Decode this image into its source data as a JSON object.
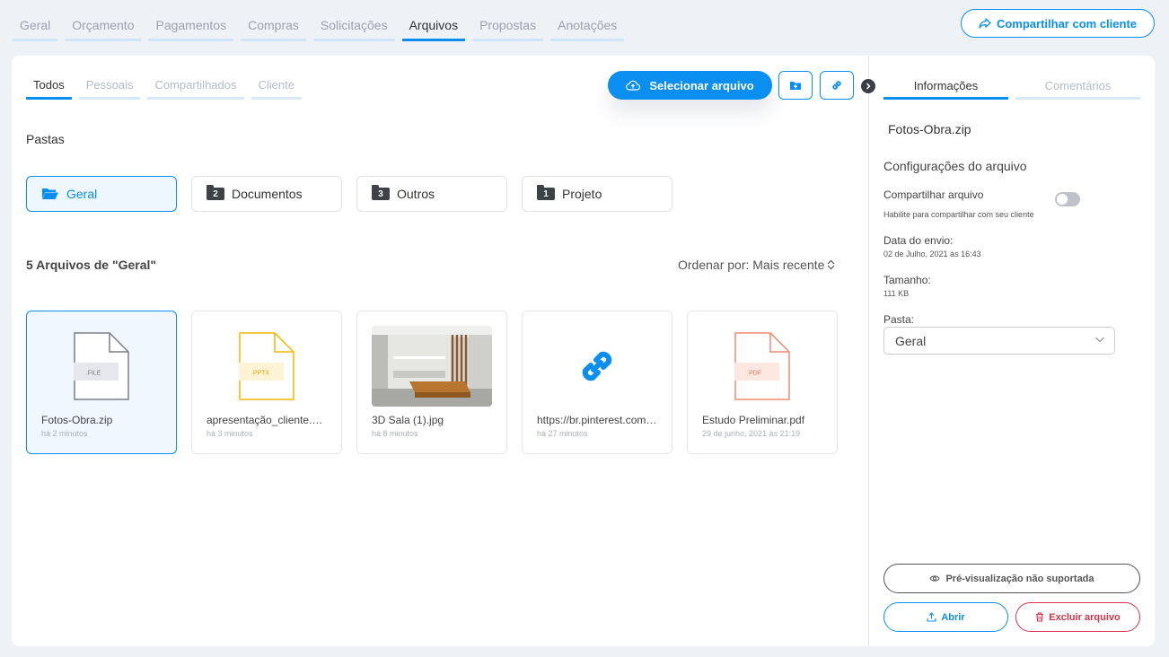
{
  "top_tabs": [
    "Geral",
    "Orçamento",
    "Pagamentos",
    "Compras",
    "Solicitações",
    "Arquivos",
    "Propostas",
    "Anotações"
  ],
  "share_client_label": "Compartilhar com cliente",
  "sub_tabs": [
    "Todos",
    "Pessoais",
    "Compartilhados",
    "Cliente"
  ],
  "select_file_label": "Selecionar arquivo",
  "folders_title": "Pastas",
  "folders": [
    {
      "name": "Geral",
      "count": ""
    },
    {
      "name": "Documentos",
      "count": "2"
    },
    {
      "name": "Outros",
      "count": "3"
    },
    {
      "name": "Projeto",
      "count": "1"
    }
  ],
  "files_title": "5 Arquivos de \"Geral\"",
  "sort_label": "Ordenar por: Mais recente",
  "files": [
    {
      "name": "Fotos-Obra.zip",
      "time": "há 2 minutos",
      "ext": ".FILE",
      "color": "#7b7f86"
    },
    {
      "name": "apresentação_cliente.pptx",
      "time": "há 3 minutos",
      "ext": ".PPTX",
      "color": "#f2b705"
    },
    {
      "name": "3D Sala (1).jpg",
      "time": "há 8 minutos",
      "ext": "",
      "color": ""
    },
    {
      "name": "https://br.pinterest.com/pin",
      "time": "há 27 minutos",
      "ext": "",
      "color": "#0a8ef0"
    },
    {
      "name": "Estudo Preliminar.pdf",
      "time": "29 de junho, 2021 às 21:19",
      "ext": ".PDF",
      "color": "#f08a6e"
    }
  ],
  "info": {
    "tabs": [
      "Informações",
      "Comentários"
    ],
    "file_name": "Fotos-Obra.zip",
    "settings_title": "Configurações do arquivo",
    "share_label": "Compartilhar arquivo",
    "share_hint": "Habilite para compartilhar com seu cliente",
    "sent_label": "Data do envio:",
    "sent_value": "02 de Julho, 2021 às 16:43",
    "size_label": "Tamanho:",
    "size_value": "111 KB",
    "folder_label": "Pasta:",
    "folder_value": "Geral",
    "preview_label": "Pré-visualização não suportada",
    "open_label": "Abrir",
    "delete_label": "Excluir arquivo"
  },
  "colors": {
    "accent": "#0a8ef0",
    "danger": "#d6334a"
  }
}
